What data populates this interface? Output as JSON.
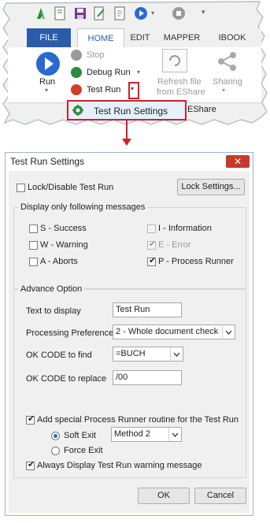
{
  "ribbon": {
    "tabs": [
      "FILE",
      "HOME",
      "EDIT",
      "MAPPER",
      "IBOOK"
    ],
    "run_label": "Run",
    "stop_label": "Stop",
    "debug_run_label": "Debug Run",
    "test_run_label": "Test Run",
    "refresh_label_1": "Refresh file",
    "refresh_label_2": "from EShare",
    "sharing_label": "Sharing",
    "eshare_label": "EShare",
    "menu_item_label": "Test Run Settings",
    "accent_color": "#2a5caa",
    "highlight_color": "#d0202a"
  },
  "dialog": {
    "title": "Test Run Settings",
    "close_glyph": "✕",
    "lock_checkbox_label": "Lock/Disable Test Run",
    "lock_settings_button": "Lock Settings...",
    "messages_group_title": "Display only following messages",
    "messages": {
      "success": "S - Success",
      "information": "I - Information",
      "warning": "W - Warning",
      "error": "E - Error",
      "aborts": "A - Aborts",
      "process_runner": "P - Process Runner"
    },
    "advance_group_title": "Advance Option",
    "text_to_display_label": "Text to display",
    "text_to_display_value": "Test Run",
    "processing_preference_label": "Processing Preference",
    "processing_preference_value": "2 - Whole document check",
    "ok_code_find_label": "OK CODE to find",
    "ok_code_find_value": "=BUCH",
    "ok_code_replace_label": "OK CODE to replace",
    "ok_code_replace_value": "/00",
    "add_routine_label": "Add special Process Runner routine for the Test Run",
    "soft_exit_label": "Soft Exit",
    "soft_exit_method": "Method 2",
    "force_exit_label": "Force Exit",
    "always_display_label": "Always Display Test Run warning message",
    "ok_button": "OK",
    "cancel_button": "Cancel",
    "check_glyph": "✔"
  }
}
